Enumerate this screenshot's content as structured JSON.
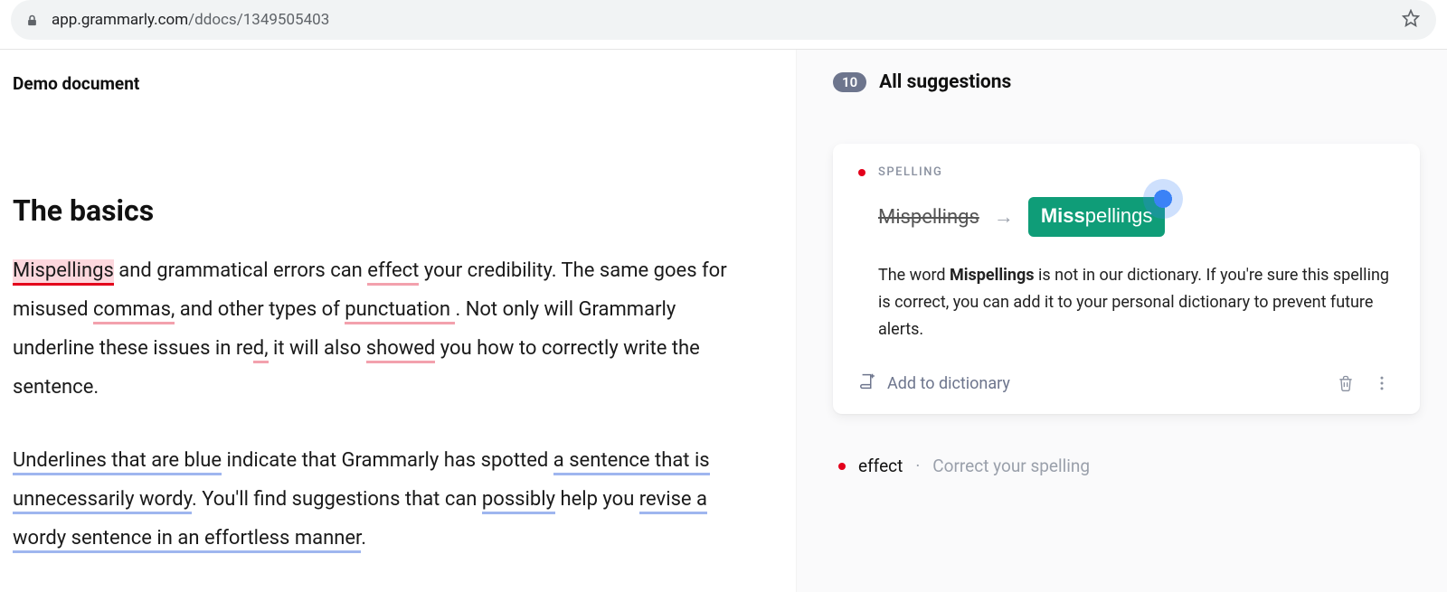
{
  "browser": {
    "url_host": "app.grammarly.com",
    "url_path": "/ddocs/1349505403"
  },
  "document": {
    "name": "Demo document",
    "heading": "The basics",
    "p1": {
      "s1": "Mispellings",
      "s2": " and grammatical errors can ",
      "s3": "effect",
      "s4": " your credibility. The same goes for misused ",
      "s5": "commas,",
      "s6": " and other types of ",
      "s7": "punctuation ",
      "s8": ". Not only will Grammarly underline these issues in re",
      "s9": "d,",
      "s10": " it will also ",
      "s11": "showed",
      "s12": " you how to correctly write the sentence."
    },
    "p2": {
      "s1": "Underlines that are blue",
      "s2": " indicate that Grammarly has spotted ",
      "s3": "a sentence that is unnecessarily wordy",
      "s4": ". You'll find suggestions that can ",
      "s5": "possibly",
      "s6": " help you ",
      "s7": "revise a wordy sentence in an effortless manner",
      "s8": "."
    }
  },
  "panel": {
    "count": "10",
    "title": "All suggestions",
    "card": {
      "category": "SPELLING",
      "original": "Mispellings",
      "fix_prefix": "Miss",
      "fix_suffix": "pellings",
      "explain_pre": "The word ",
      "explain_word": "Mispellings",
      "explain_post": " is not in our dictionary. If you're sure this spelling is correct, you can add it to your personal dictionary to prevent future alerts.",
      "add_label": "Add to dictionary"
    },
    "next": {
      "word": "effect",
      "sep": "·",
      "hint": "Correct your spelling"
    }
  }
}
